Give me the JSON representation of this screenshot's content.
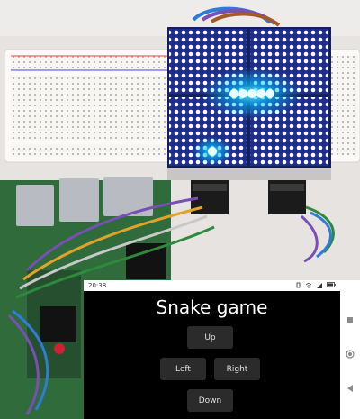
{
  "status_bar": {
    "time": "20:38",
    "icons": [
      "vibrate-icon",
      "wifi-icon",
      "signal-icon",
      "battery-icon"
    ]
  },
  "app": {
    "title": "Snake game",
    "buttons": {
      "up": "Up",
      "left": "Left",
      "right": "Right",
      "down": "Down"
    }
  },
  "nav_bar": {
    "icons": [
      "recents-icon",
      "home-icon",
      "back-icon"
    ]
  },
  "colors": {
    "led_glow": "#00c8ff",
    "breadboard": "#ffffff",
    "pcb_green": "#2f6b3b",
    "button_bg": "#2b2b2b"
  }
}
